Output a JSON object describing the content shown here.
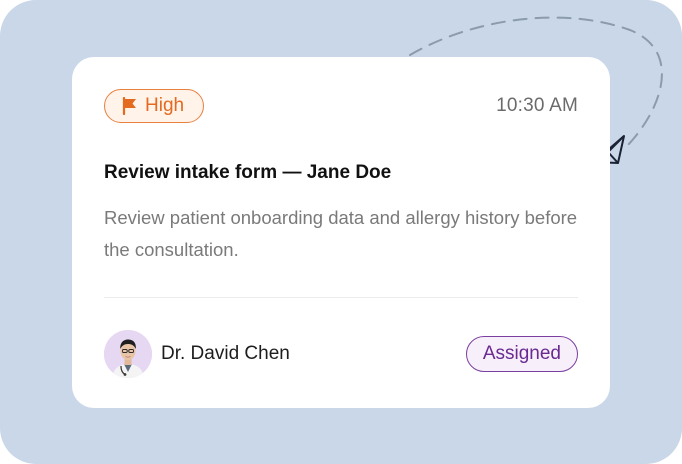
{
  "task_card": {
    "priority": {
      "label": "High",
      "icon": "flag-icon",
      "color": "#e46a20"
    },
    "time": "10:30 AM",
    "title": "Review intake form — Jane Doe",
    "description": "Review patient onboarding data and allergy history before the consultation.",
    "assignee": {
      "name": "Dr. David Chen",
      "avatar_icon": "doctor-avatar"
    },
    "status": {
      "label": "Assigned",
      "color": "#6a2a91"
    }
  },
  "decoration": {
    "icon": "paper-plane-icon"
  },
  "colors": {
    "background": "#c9d7e8",
    "card": "#ffffff",
    "priority": "#e46a20",
    "status": "#6a2a91"
  }
}
